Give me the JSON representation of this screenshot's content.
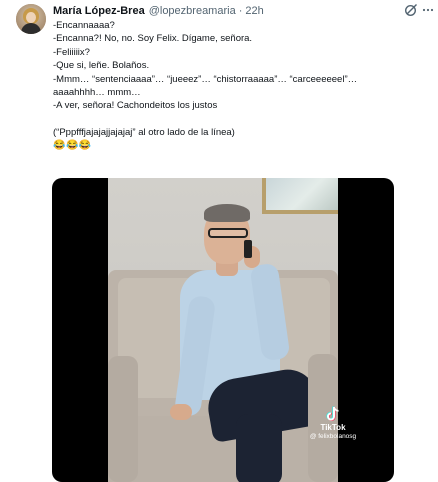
{
  "tweet": {
    "author": "María López-Brea",
    "handle": "@lopezbreamaria",
    "separator": "·",
    "time": "22h",
    "lines": [
      "-Encannaaaa?",
      "-Encanna?! No, no. Soy Felix. Dígame, señora.",
      "-Feliiiiix?",
      "-Que si, leñe. Bolaños.",
      "-Mmm… “sentenciaaaa”… “jueeez”… “chistorraaaaa”… “carceeeeeel”…",
      "aaaahhhh… mmm…",
      "-A ver, señora! Cachondeitos los justos",
      "(“Pppfffjajajajjajajaj” al otro lado de la línea)"
    ],
    "emojis": "😂😂😂"
  },
  "media": {
    "watermark_brand": "TikTok",
    "watermark_user": "@ felixbolanosg"
  },
  "icons": [
    "grok-icon",
    "more-icon",
    "tiktok-icon"
  ],
  "colors": {
    "text": "#0f1419",
    "secondary": "#536471",
    "media_bg": "#000000"
  }
}
